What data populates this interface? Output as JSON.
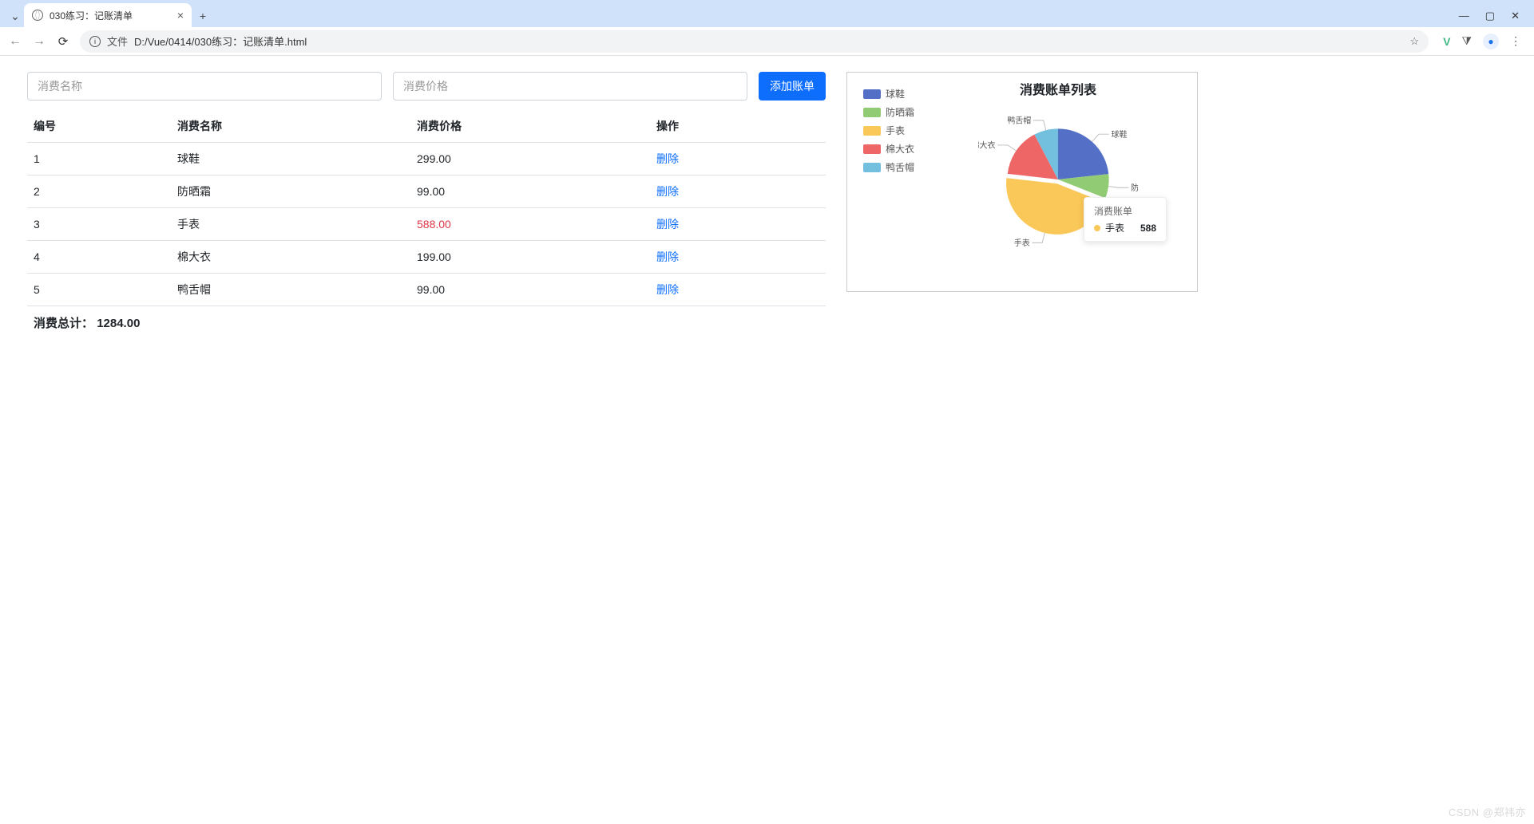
{
  "browser": {
    "tab_title": "030练习：记账清单",
    "file_label": "文件",
    "url": "D:/Vue/0414/030练习：记账清单.html",
    "window_controls": {
      "min": "—",
      "max": "▢",
      "close": "✕"
    }
  },
  "form": {
    "name_placeholder": "消费名称",
    "price_placeholder": "消费价格",
    "add_button": "添加账单"
  },
  "table": {
    "headers": {
      "id": "编号",
      "name": "消费名称",
      "price": "消费价格",
      "action": "操作"
    },
    "rows": [
      {
        "id": "1",
        "name": "球鞋",
        "price": "299.00",
        "highlight": false
      },
      {
        "id": "2",
        "name": "防晒霜",
        "price": "99.00",
        "highlight": false
      },
      {
        "id": "3",
        "name": "手表",
        "price": "588.00",
        "highlight": true
      },
      {
        "id": "4",
        "name": "棉大衣",
        "price": "199.00",
        "highlight": false
      },
      {
        "id": "5",
        "name": "鸭舌帽",
        "price": "99.00",
        "highlight": false
      }
    ],
    "delete_label": "删除",
    "total_label": "消费总计：",
    "total_value": "1284.00"
  },
  "chart_data": {
    "type": "pie",
    "title": "消费账单列表",
    "series_name": "消费账单",
    "slices": [
      {
        "name": "球鞋",
        "value": 299,
        "color": "#5470c6"
      },
      {
        "name": "防晒霜",
        "value": 99,
        "color": "#91cc75"
      },
      {
        "name": "手表",
        "value": 588,
        "color": "#fac858"
      },
      {
        "name": "棉大衣",
        "value": 199,
        "color": "#ee6666"
      },
      {
        "name": "鸭舌帽",
        "value": 99,
        "color": "#73c0de"
      }
    ],
    "tooltip": {
      "series": "消费账单",
      "name": "手表",
      "value": "588",
      "color": "#fac858"
    }
  },
  "watermark": "CSDN @郑祎亦"
}
